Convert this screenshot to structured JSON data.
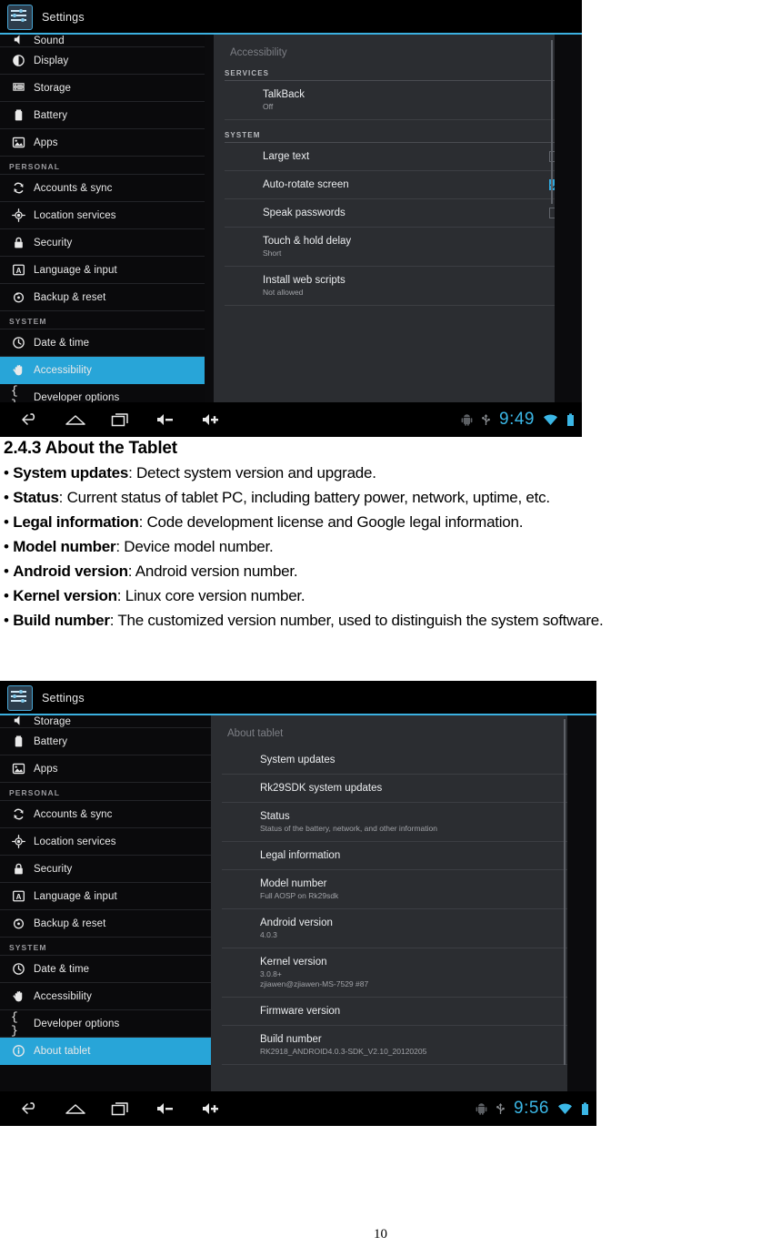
{
  "page": {
    "number": "10"
  },
  "screenshot_accessibility": {
    "title": "Settings",
    "title_icon": "settings-sliders-icon",
    "sidebar": {
      "partial_top_item": "Sound",
      "items": [
        {
          "label": "Display",
          "icon": "brightness-icon",
          "selected": false
        },
        {
          "label": "Storage",
          "icon": "storage-stack-icon",
          "selected": false
        },
        {
          "label": "Battery",
          "icon": "battery-icon",
          "selected": false
        },
        {
          "label": "Apps",
          "icon": "apps-image-icon",
          "selected": false
        }
      ],
      "section_personal": "PERSONAL",
      "personal_items": [
        {
          "label": "Accounts & sync",
          "icon": "sync-icon",
          "selected": false
        },
        {
          "label": "Location services",
          "icon": "location-crosshair-icon",
          "selected": false
        },
        {
          "label": "Security",
          "icon": "lock-icon",
          "selected": false
        },
        {
          "label": "Language & input",
          "icon": "language-letter-icon",
          "selected": false
        },
        {
          "label": "Backup & reset",
          "icon": "backup-restore-icon",
          "selected": false
        }
      ],
      "section_system": "SYSTEM",
      "system_items": [
        {
          "label": "Date & time",
          "icon": "clock-icon",
          "selected": false
        },
        {
          "label": "Accessibility",
          "icon": "hand-icon",
          "selected": true
        },
        {
          "label": "Developer options",
          "icon": "braces-icon",
          "selected": false
        }
      ]
    },
    "panel": {
      "title": "Accessibility",
      "head_services": "SERVICES",
      "head_system": "SYSTEM",
      "services_rows": [
        {
          "title": "TalkBack",
          "summary": "Off",
          "checkbox": "none"
        }
      ],
      "system_rows": [
        {
          "title": "Large text",
          "summary": "",
          "checkbox": "unchecked"
        },
        {
          "title": "Auto-rotate screen",
          "summary": "",
          "checkbox": "checked"
        },
        {
          "title": "Speak passwords",
          "summary": "",
          "checkbox": "unchecked"
        },
        {
          "title": "Touch & hold delay",
          "summary": "Short",
          "checkbox": "none"
        },
        {
          "title": "Install web scripts",
          "summary": "Not allowed",
          "checkbox": "none"
        }
      ]
    },
    "navbar": {
      "back": "back-icon",
      "home": "home-icon",
      "recents": "recents-icon",
      "volume_down": "volume-down-icon",
      "volume_up": "volume-up-icon",
      "android_status": "android-robot-icon",
      "usb_status": "usb-icon",
      "clock": "9:49",
      "wifi": "wifi-icon",
      "battery": "battery-status-icon"
    }
  },
  "body_text": {
    "heading": "2.4.3 About the Tablet",
    "bullets": [
      {
        "term": "System updates",
        "desc": ": Detect system version and upgrade."
      },
      {
        "term": "Status",
        "desc": ": Current status of tablet PC, including battery power, network, uptime, etc."
      },
      {
        "term": "Legal information",
        "desc": ": Code development license and Google legal information."
      },
      {
        "term": "Model number",
        "desc": ": Device model number."
      },
      {
        "term": "Android version",
        "desc": ": Android version number."
      },
      {
        "term": "Kernel version",
        "desc": ": Linux core version number."
      },
      {
        "term": "Build number",
        "desc": ": The customized version number, used to distinguish the system software."
      }
    ]
  },
  "screenshot_about": {
    "title": "Settings",
    "title_icon": "settings-sliders-icon",
    "sidebar": {
      "partial_top_item": "Storage",
      "items": [
        {
          "label": "Battery",
          "icon": "battery-icon",
          "selected": false
        },
        {
          "label": "Apps",
          "icon": "apps-image-icon",
          "selected": false
        }
      ],
      "section_personal": "PERSONAL",
      "personal_items": [
        {
          "label": "Accounts & sync",
          "icon": "sync-icon",
          "selected": false
        },
        {
          "label": "Location services",
          "icon": "location-crosshair-icon",
          "selected": false
        },
        {
          "label": "Security",
          "icon": "lock-icon",
          "selected": false
        },
        {
          "label": "Language & input",
          "icon": "language-letter-icon",
          "selected": false
        },
        {
          "label": "Backup & reset",
          "icon": "backup-restore-icon",
          "selected": false
        }
      ],
      "section_system": "SYSTEM",
      "system_items": [
        {
          "label": "Date & time",
          "icon": "clock-icon",
          "selected": false
        },
        {
          "label": "Accessibility",
          "icon": "hand-icon",
          "selected": false
        },
        {
          "label": "Developer options",
          "icon": "braces-icon",
          "selected": false
        },
        {
          "label": "About tablet",
          "icon": "info-circle-icon",
          "selected": true
        }
      ]
    },
    "panel": {
      "title": "About tablet",
      "rows": [
        {
          "title": "System updates",
          "summary": ""
        },
        {
          "title": "Rk29SDK system updates",
          "summary": ""
        },
        {
          "title": "Status",
          "summary": "Status of the battery, network, and other information"
        },
        {
          "title": "Legal information",
          "summary": ""
        },
        {
          "title": "Model number",
          "summary": "Full AOSP on Rk29sdk"
        },
        {
          "title": "Android version",
          "summary": "4.0.3"
        },
        {
          "title": "Kernel version",
          "summary": "3.0.8+\nzjiawen@zjiawen-MS-7529 #87"
        },
        {
          "title": "Firmware version",
          "summary": ""
        },
        {
          "title": "Build number",
          "summary": "RK2918_ANDROID4.0.3-SDK_V2.10_20120205"
        }
      ]
    },
    "navbar": {
      "back": "back-icon",
      "home": "home-icon",
      "recents": "recents-icon",
      "volume_down": "volume-down-icon",
      "volume_up": "volume-up-icon",
      "android_status": "android-robot-icon",
      "usb_status": "usb-icon",
      "clock": "9:56",
      "wifi": "wifi-icon",
      "battery": "battery-status-icon"
    }
  },
  "colors": {
    "accent": "#3bb0e0",
    "selection": "#28a5d8",
    "panel_bg": "#2b2d31",
    "sidebar_bg": "#0a0a0c",
    "clock": "#3bb7e6"
  }
}
